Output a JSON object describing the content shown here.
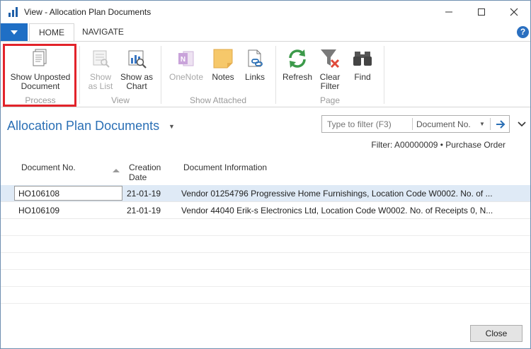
{
  "window": {
    "title": "View - Allocation Plan Documents"
  },
  "ribbon_tabs": [
    {
      "label": "HOME",
      "active": true
    },
    {
      "label": "NAVIGATE",
      "active": false
    }
  ],
  "ribbon": {
    "show_unposted": {
      "line1": "Show Unposted",
      "line2": "Document",
      "icon": "document-icon"
    },
    "process_label": "Process",
    "show_as_list": {
      "line1": "Show",
      "line2": "as List",
      "icon": "list-icon",
      "disabled": true
    },
    "show_as_chart": {
      "line1": "Show as",
      "line2": "Chart",
      "icon": "chart-icon"
    },
    "view_label": "View",
    "onenote": {
      "label": "OneNote",
      "icon": "onenote-icon",
      "disabled": true
    },
    "notes": {
      "label": "Notes",
      "icon": "note-icon"
    },
    "links": {
      "label": "Links",
      "icon": "link-icon"
    },
    "show_attached_label": "Show Attached",
    "refresh": {
      "label": "Refresh",
      "icon": "refresh-icon"
    },
    "clear_filter": {
      "line1": "Clear",
      "line2": "Filter",
      "icon": "clear-filter-icon"
    },
    "find": {
      "label": "Find",
      "icon": "binoculars-icon"
    },
    "page_label": "Page"
  },
  "page": {
    "title": "Allocation Plan Documents",
    "filter_placeholder": "Type to filter (F3)",
    "filter_field": "Document No.",
    "filter_text": "Filter: A00000009 • Purchase Order"
  },
  "columns": {
    "doc_no": "Document No.",
    "creation_line1": "Creation",
    "creation_line2": "Date",
    "info": "Document Information"
  },
  "rows": [
    {
      "doc_no": "HO106108",
      "date": "21-01-19",
      "info": "Vendor 01254796 Progressive Home Furnishings, Location Code W0002. No. of ..."
    },
    {
      "doc_no": "HO106109",
      "date": "21-01-19",
      "info": "Vendor 44040 Erik-s Electronics Ltd, Location Code W0002. No. of Receipts 0, N..."
    }
  ],
  "footer": {
    "close_label": "Close"
  },
  "colors": {
    "accent": "#2a6fb5",
    "file_button": "#1f6fc5",
    "highlight": "#e2232a",
    "selected_row": "#dfeaf6"
  }
}
